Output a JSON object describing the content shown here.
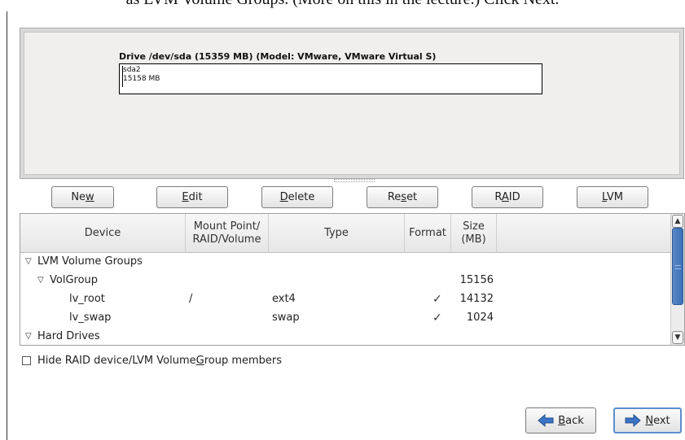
{
  "doc": {
    "top_text": "as LVM Volume Groups. (More on this in the lecture.)  Click Next."
  },
  "drive": {
    "title": "Drive /dev/sda (15359 MB) (Model: VMware, VMware Virtual S)",
    "segment_name": "sda2",
    "segment_size": "15158 MB"
  },
  "buttons": {
    "new": {
      "pre": "Ne",
      "ul": "w",
      "post": ""
    },
    "edit": {
      "pre": "",
      "ul": "E",
      "post": "dit"
    },
    "delete": {
      "pre": "",
      "ul": "D",
      "post": "elete"
    },
    "reset": {
      "pre": "Re",
      "ul": "s",
      "post": "et"
    },
    "raid": {
      "pre": "R",
      "ul": "A",
      "post": "ID"
    },
    "lvm": {
      "pre": "",
      "ul": "L",
      "post": "VM"
    }
  },
  "table": {
    "headers": {
      "device": "Device",
      "mount_line1": "Mount Point/",
      "mount_line2": "RAID/Volume",
      "type": "Type",
      "format": "Format",
      "size_line1": "Size",
      "size_line2": "(MB)"
    },
    "rows": [
      {
        "device": "LVM Volume Groups",
        "mount": "",
        "type": "",
        "format": "",
        "size": ""
      },
      {
        "device": "VolGroup",
        "mount": "",
        "type": "",
        "format": "",
        "size": "15156"
      },
      {
        "device": "lv_root",
        "mount": "/",
        "type": "ext4",
        "format": "✓",
        "size": "14132"
      },
      {
        "device": "lv_swap",
        "mount": "",
        "type": "swap",
        "format": "✓",
        "size": "1024"
      },
      {
        "device": "Hard Drives",
        "mount": "",
        "type": "",
        "format": "",
        "size": ""
      }
    ],
    "expander": "▽"
  },
  "hide_members": {
    "pre": "Hide RAID device/LVM Volume ",
    "ul": "G",
    "post": "roup members",
    "checked": false
  },
  "nav": {
    "back": {
      "ul": "B",
      "post": "ack"
    },
    "next": {
      "ul": "N",
      "post": "ext"
    }
  },
  "colors": {
    "arrow_blue": "#3b73c6",
    "accent_border": "#5c8fcf"
  }
}
